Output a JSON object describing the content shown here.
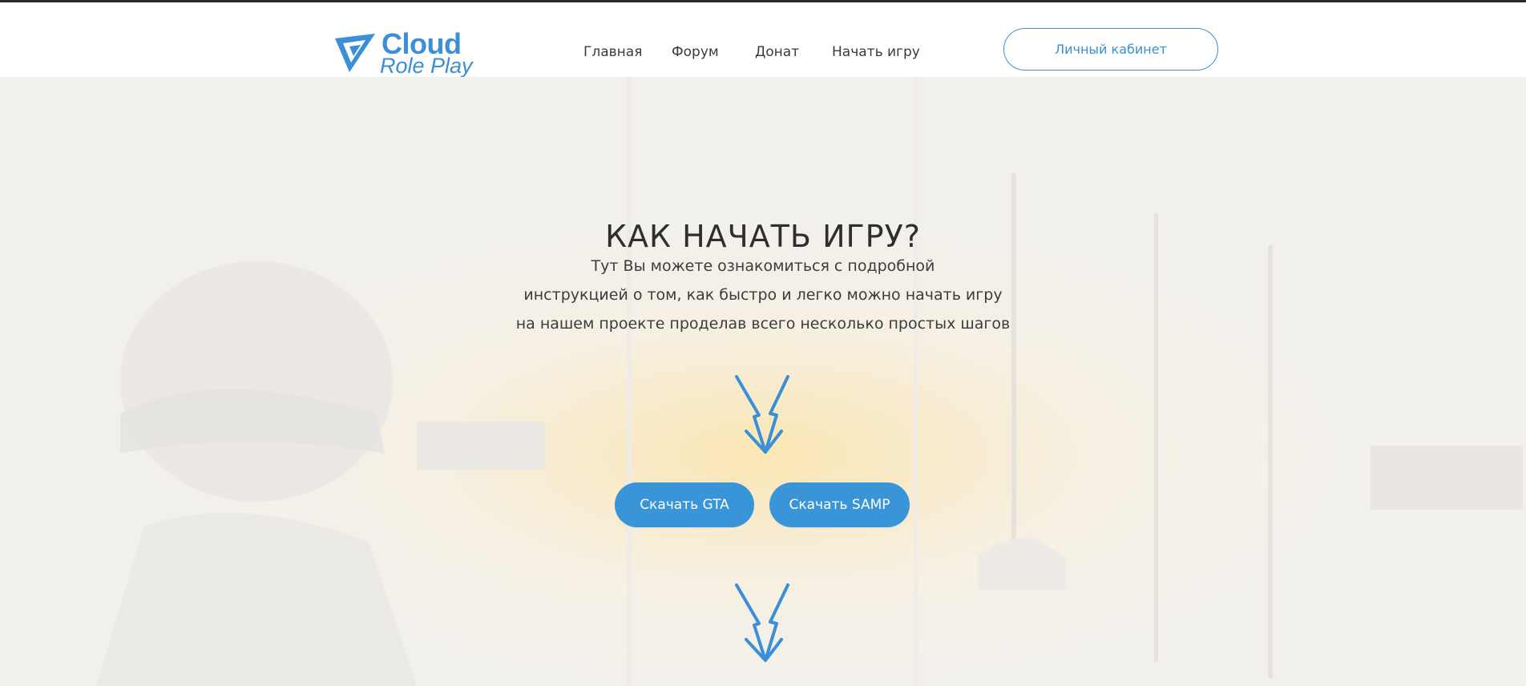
{
  "logo": {
    "line1": "Cloud",
    "line2": "Role Play"
  },
  "nav": [
    {
      "label": "Главная"
    },
    {
      "label": "Форум"
    },
    {
      "label": "Донат"
    },
    {
      "label": "Начать игру"
    }
  ],
  "cabinet_button": "Личный кабинет",
  "hero": {
    "title": "КАК НАЧАТЬ ИГРУ?",
    "lines": [
      "Тут Вы можете ознакомиться с подробной",
      "инструкцией о том, как быстро и легко можно начать игру",
      "на нашем проекте проделав всего несколько простых шагов"
    ]
  },
  "buttons": {
    "gta": "Скачать GTA",
    "samp": "Скачать SAMP"
  },
  "colors": {
    "accent": "#3a95d8",
    "topline": "#2b2b2b",
    "text": "#2e2e2e"
  },
  "icons": {
    "arrow": "lightning-arrow-down-icon",
    "logo": "triangle-logo-icon"
  }
}
